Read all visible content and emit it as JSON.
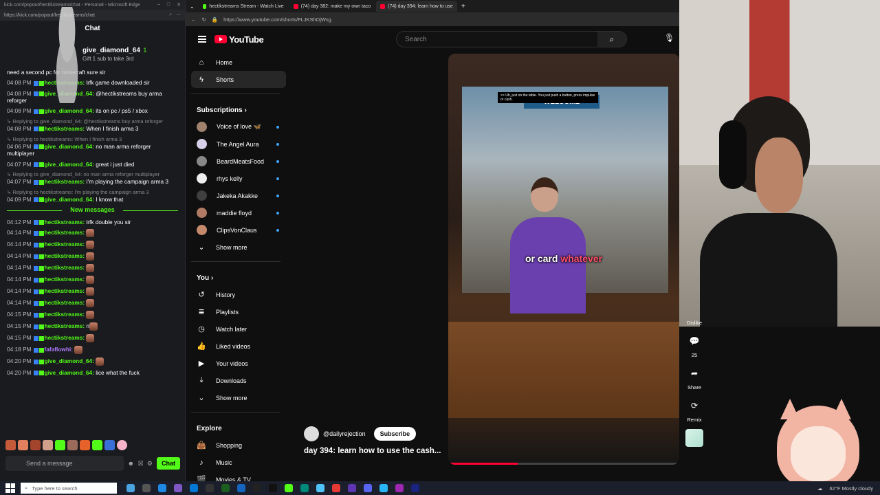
{
  "kick": {
    "window_title": "kick.com/popout/hectikstreams/chat - Personal - Microsoft Edge",
    "url": "https://kick.com/popout/hectikstreams/chat",
    "chat_header": "Chat",
    "pinned": {
      "user": "give_diamond_64",
      "sub": "Gift 1 sub to take 3rd",
      "count": "1"
    },
    "first_line": "need a second pc for minecraft sure sir",
    "messages": [
      {
        "time": "04:08 PM",
        "user": "hectikstreams",
        "color": "#53fc18",
        "text": "lrfk game downloaded sir"
      },
      {
        "time": "04:08 PM",
        "user": "give_diamond_64",
        "color": "#53fc18",
        "text": "@hectikstreams buy arma reforger"
      },
      {
        "time": "04:08 PM",
        "user": "give_diamond_64",
        "color": "#53fc18",
        "text": "its on pc / ps5 / xbox"
      },
      {
        "reply": "Replying to give_diamond_64: @hectikstreams buy arma reforger",
        "time": "04:08 PM",
        "user": "hectikstreams",
        "color": "#53fc18",
        "text": "When I finish arma 3"
      },
      {
        "reply": "Replying to hectikstreams: When I finish arma 3",
        "time": "04:06 PM",
        "user": "give_diamond_64",
        "color": "#53fc18",
        "text": "no man arma reforger multiplayer"
      },
      {
        "time": "04:07 PM",
        "user": "give_diamond_64",
        "color": "#53fc18",
        "text": "great i just died"
      },
      {
        "reply": "Replying to give_diamond_64: no man arma reforger multiplayer",
        "time": "04:07 PM",
        "user": "hectikstreams",
        "color": "#53fc18",
        "text": "I'm playing the campaign arma 3"
      },
      {
        "reply": "Replying to hectikstreams: I'm playing the campaign arma 3",
        "time": "04:09 PM",
        "user": "give_diamond_64",
        "color": "#53fc18",
        "text": "I know that"
      }
    ],
    "new_messages_label": "New messages",
    "new_messages": [
      {
        "time": "04:12 PM",
        "user": "hectikstreams",
        "color": "#53fc18",
        "text": "lrfk double you sir"
      },
      {
        "time": "04:14 PM",
        "user": "hectikstreams",
        "color": "#53fc18",
        "text": ""
      },
      {
        "time": "04:14 PM",
        "user": "hectikstreams",
        "color": "#53fc18",
        "text": ""
      },
      {
        "time": "04:14 PM",
        "user": "hectikstreams",
        "color": "#53fc18",
        "text": ""
      },
      {
        "time": "04:14 PM",
        "user": "hectikstreams",
        "color": "#53fc18",
        "text": ""
      },
      {
        "time": "04:14 PM",
        "user": "hectikstreams",
        "color": "#53fc18",
        "text": ""
      },
      {
        "time": "04:14 PM",
        "user": "hectikstreams",
        "color": "#53fc18",
        "text": ""
      },
      {
        "time": "04:14 PM",
        "user": "hectikstreams",
        "color": "#53fc18",
        "text": ""
      },
      {
        "time": "04:15 PM",
        "user": "hectikstreams",
        "color": "#53fc18",
        "text": ""
      },
      {
        "time": "04:15 PM",
        "user": "hectikstreams",
        "color": "#53fc18",
        "text": "n"
      },
      {
        "time": "04:15 PM",
        "user": "hectikstreams",
        "color": "#53fc18",
        "text": ""
      },
      {
        "time": "04:18 PM",
        "user": "fafaflowhi",
        "color": "#b07cff",
        "text": ""
      },
      {
        "time": "04:20 PM",
        "user": "give_diamond_64",
        "color": "#53fc18",
        "text": ""
      },
      {
        "time": "04:20 PM",
        "user": "give_diamond_64",
        "color": "#53fc18",
        "text": "lice what the fuck"
      }
    ],
    "send_placeholder": "Send a message",
    "chat_button": "Chat"
  },
  "browser": {
    "tabs": [
      {
        "label": "hectikstreams Stream - Watch Live"
      },
      {
        "label": "(74) day 382: make my own taco"
      },
      {
        "label": "(74) day 394: learn how to use"
      }
    ],
    "url": "https://www.youtube.com/shorts/FLJKShDjWsg"
  },
  "youtube": {
    "logo": "YouTube",
    "search_placeholder": "Search",
    "nav": [
      {
        "label": "Home",
        "icon": "home-icon",
        "glyph": "⌂"
      },
      {
        "label": "Shorts",
        "icon": "shorts-icon",
        "glyph": "ϟ"
      }
    ],
    "subs_heading": "Subscriptions",
    "subs": [
      {
        "label": "Voice of love 🦋",
        "color": "#a0826d"
      },
      {
        "label": "The Angel Aura",
        "color": "#d8d0e8"
      },
      {
        "label": "BeardMeatsFood",
        "color": "#888"
      },
      {
        "label": "rhys kelly",
        "color": "#eee"
      },
      {
        "label": "Jakeka Akakke",
        "color": "#3f3f3f"
      },
      {
        "label": "maddie floyd",
        "color": "#b07a64"
      },
      {
        "label": "ClipsVonClaus",
        "color": "#c48a6b"
      }
    ],
    "show_more": "Show more",
    "you_heading": "You",
    "you": [
      {
        "label": "History",
        "icon": "history-icon",
        "glyph": "↺"
      },
      {
        "label": "Playlists",
        "icon": "playlists-icon",
        "glyph": "≣"
      },
      {
        "label": "Watch later",
        "icon": "clock-icon",
        "glyph": "◷"
      },
      {
        "label": "Liked videos",
        "icon": "thumbs-up-icon",
        "glyph": "👍"
      },
      {
        "label": "Your videos",
        "icon": "video-icon",
        "glyph": "▶"
      },
      {
        "label": "Downloads",
        "icon": "download-icon",
        "glyph": "⤓"
      }
    ],
    "show_more_2": "Show more",
    "explore_heading": "Explore",
    "explore": [
      {
        "label": "Shopping",
        "icon": "shopping-bag-icon",
        "glyph": "👜"
      },
      {
        "label": "Music",
        "icon": "music-icon",
        "glyph": "♪"
      },
      {
        "label": "Movies & TV",
        "icon": "film-icon",
        "glyph": "🎬"
      }
    ],
    "short": {
      "overlay_top": ">> Uh, just on the table. You just push a button, press impulse or cash.",
      "store_sign": "WELCOME",
      "subtitle_a": "or card",
      "subtitle_b": "whatever",
      "progress": 0.3,
      "channel": "@dailyrejection",
      "subscribe": "Subscribe",
      "title": "day 394: learn how to use the cash..."
    },
    "actions": {
      "dislike": "Dislike",
      "comments": "25",
      "share": "Share",
      "remix": "Remix"
    }
  },
  "taskbar": {
    "search_placeholder": "Type here to search",
    "weather": "62°F  Mostly cloudy"
  }
}
